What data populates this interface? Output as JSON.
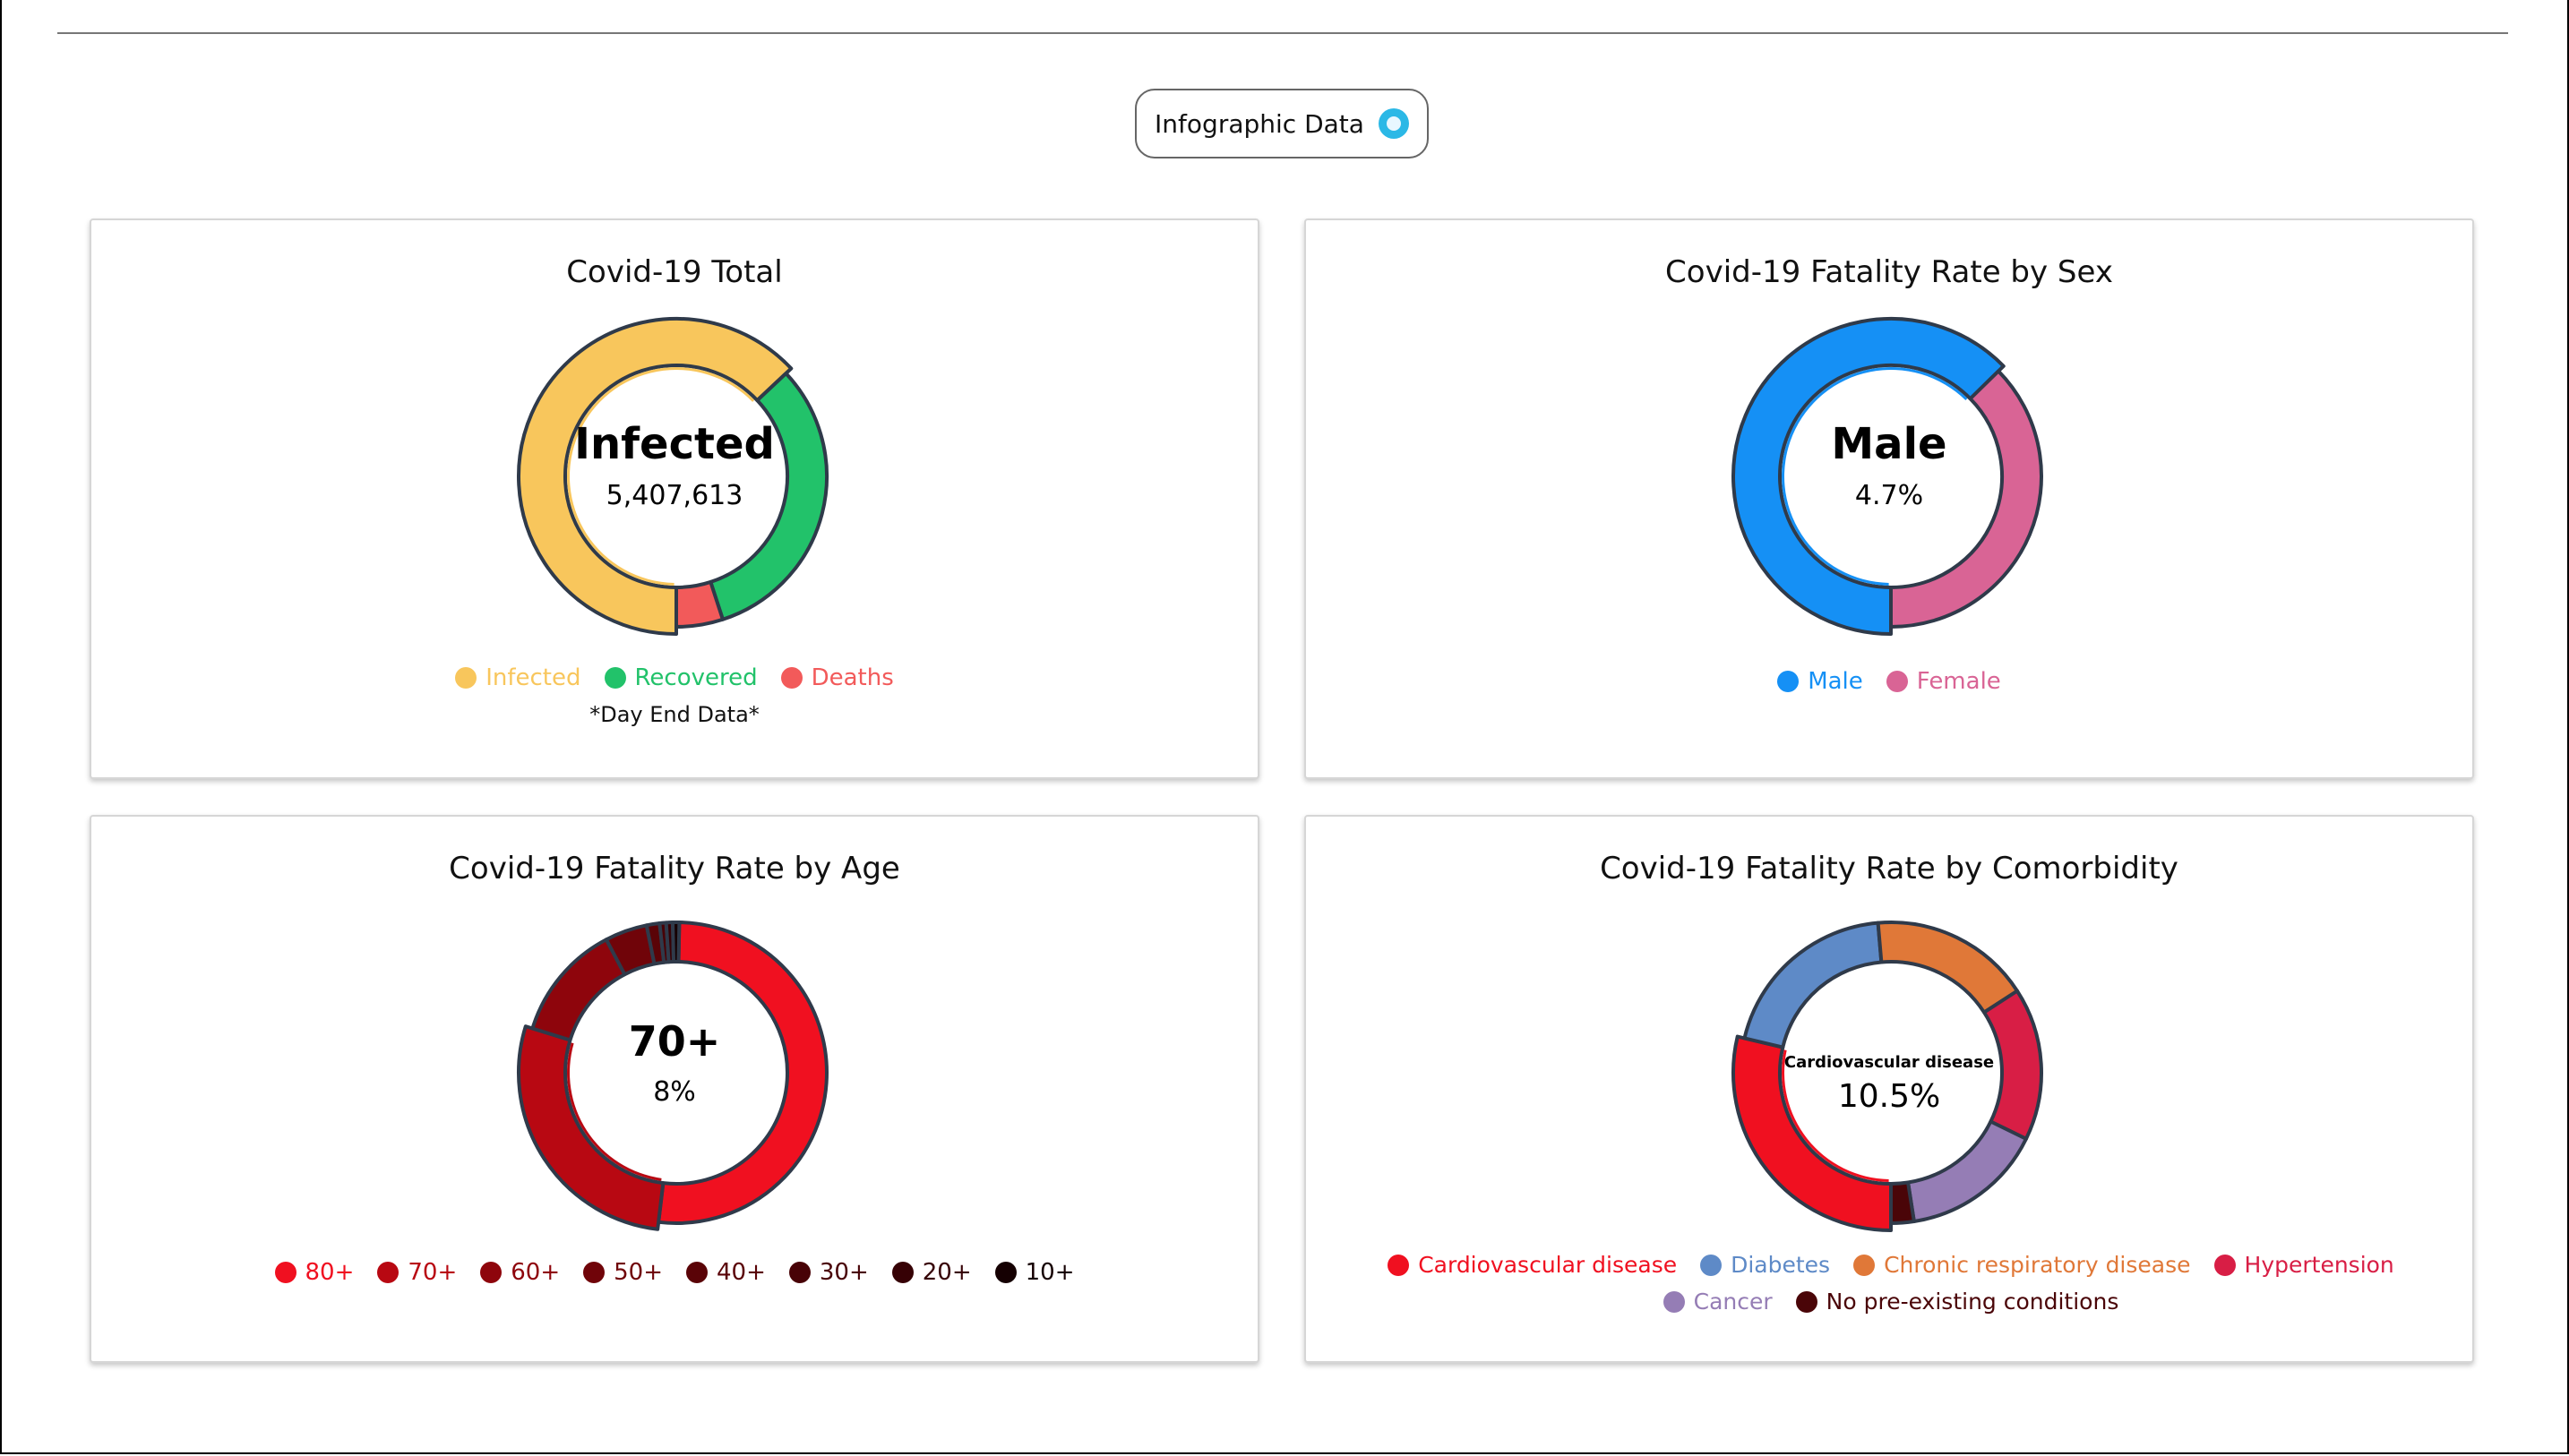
{
  "header": {
    "button_label": "Infographic Data",
    "button_icon": "chart-icon"
  },
  "cards": [
    {
      "title": "Covid-19 Total",
      "center_label": "Infected",
      "center_value": "5,407,613",
      "note": "*Day End Data*",
      "legend": [
        {
          "label": "Infected",
          "color": "#F8C65C"
        },
        {
          "label": "Recovered",
          "color": "#22C26A"
        },
        {
          "label": "Deaths",
          "color": "#F25A5A"
        }
      ]
    },
    {
      "title": "Covid-19 Fatality Rate by Sex",
      "center_label": "Male",
      "center_value": "4.7%",
      "legend": [
        {
          "label": "Male",
          "color": "#1590F5"
        },
        {
          "label": "Female",
          "color": "#D96495"
        }
      ]
    },
    {
      "title": "Covid-19 Fatality Rate by Age",
      "center_label": "70+",
      "center_value": "8%",
      "legend": [
        {
          "label": "80+",
          "color": "#F01020"
        },
        {
          "label": "70+",
          "color": "#B80812"
        },
        {
          "label": "60+",
          "color": "#8E050C"
        },
        {
          "label": "50+",
          "color": "#700409"
        },
        {
          "label": "40+",
          "color": "#5A0307"
        },
        {
          "label": "30+",
          "color": "#480206"
        },
        {
          "label": "20+",
          "color": "#360105"
        },
        {
          "label": "10+",
          "color": "#150002"
        }
      ]
    },
    {
      "title": "Covid-19 Fatality Rate by Comorbidity",
      "center_label": "Cardiovascular disease",
      "center_value": "10.5%",
      "legend": [
        {
          "label": "Cardiovascular disease",
          "color": "#F01020"
        },
        {
          "label": "Diabetes",
          "color": "#5E8AC7"
        },
        {
          "label": "Chronic respiratory disease",
          "color": "#E07838"
        },
        {
          "label": "Hypertension",
          "color": "#D81E45"
        },
        {
          "label": "Cancer",
          "color": "#957DB5"
        },
        {
          "label": "No pre-existing conditions",
          "color": "#4A0508"
        }
      ]
    }
  ],
  "chart_data": [
    {
      "type": "pie",
      "title": "Covid-19 Total",
      "categories": [
        "Infected",
        "Recovered",
        "Deaths"
      ],
      "values": [
        63,
        32,
        5
      ]
    },
    {
      "type": "pie",
      "title": "Covid-19 Fatality Rate by Sex",
      "categories": [
        "Male",
        "Female"
      ],
      "values": [
        4.7,
        2.8
      ]
    },
    {
      "type": "pie",
      "title": "Covid-19 Fatality Rate by Age",
      "categories": [
        "80+",
        "70+",
        "60+",
        "50+",
        "40+",
        "30+",
        "20+",
        "10+"
      ],
      "values": [
        14.8,
        8,
        3.6,
        1.3,
        0.4,
        0.2,
        0.2,
        0.2
      ]
    },
    {
      "type": "pie",
      "title": "Covid-19 Fatality Rate by Comorbidity",
      "categories": [
        "Cardiovascular disease",
        "Diabetes",
        "Chronic respiratory disease",
        "Hypertension",
        "Cancer",
        "No pre-existing conditions"
      ],
      "values": [
        10.5,
        7.3,
        6.3,
        6,
        5.6,
        0.9
      ]
    }
  ]
}
